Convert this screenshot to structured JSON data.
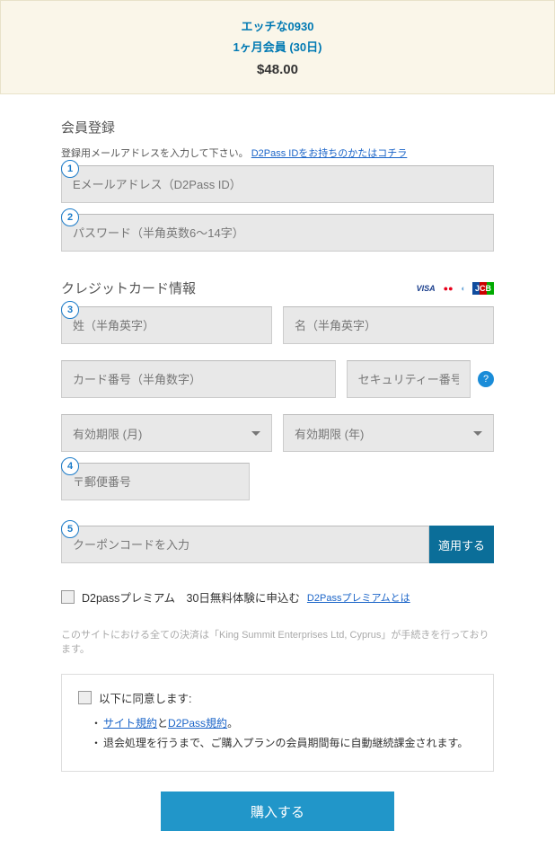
{
  "header": {
    "title": "エッチな0930",
    "plan": "1ヶ月会員 (30日)",
    "price": "$48.00"
  },
  "registration": {
    "title": "会員登録",
    "help": "登録用メールアドレスを入力して下さい。",
    "existing_link": "D2Pass IDをお持ちのかたはコチラ",
    "badge1": "1",
    "email_placeholder": "Eメールアドレス（D2Pass ID）",
    "badge2": "2",
    "password_placeholder": "パスワード（半角英数6～14字）"
  },
  "card": {
    "title": "クレジットカード情報",
    "logos": {
      "visa": "VISA",
      "mc": "●●",
      "diners": "◐",
      "jcb": "JCB"
    },
    "badge3": "3",
    "lastname_placeholder": "姓（半角英字）",
    "firstname_placeholder": "名（半角英字）",
    "number_placeholder": "カード番号（半角数字）",
    "cvv_placeholder": "セキュリティー番号",
    "info": "?",
    "exp_month": "有効期限 (月)",
    "exp_year": "有効期限 (年)",
    "badge4": "4",
    "zip_placeholder": "〒郵便番号"
  },
  "coupon": {
    "badge5": "5",
    "placeholder": "クーポンコードを入力",
    "apply": "適用する"
  },
  "premium": {
    "label": "D2passプレミアム　30日無料体験に申込む",
    "link": "D2Passプレミアムとは"
  },
  "disclaimer": "このサイトにおける全ての決済は「King Summit Enterprises Ltd, Cyprus」が手続きを行っております。",
  "terms": {
    "agree": "以下に同意します:",
    "site_terms": "サイト規約",
    "and": "と",
    "d2pass_terms": "D2Pass規約",
    "period": "。",
    "renewal": "退会処理を行うまで、ご購入プランの会員期間毎に自動継続課金されます。"
  },
  "buy": "購入する"
}
